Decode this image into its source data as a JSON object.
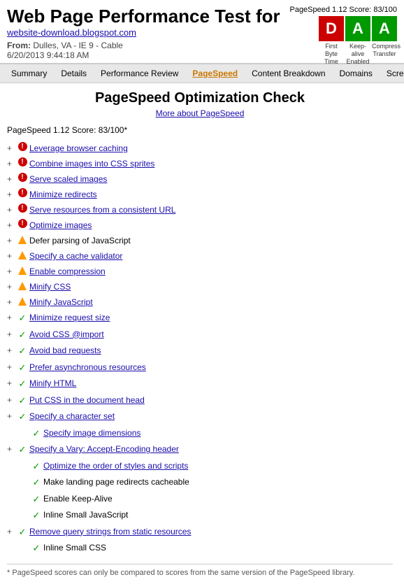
{
  "header": {
    "title": "Web Page Performance Test for",
    "site": "website-download.blogspot.com",
    "from_label": "From:",
    "from_value": "Dulles, VA - IE 9 - Cable",
    "date": "6/20/2013 9:44:18 AM"
  },
  "score_badge": {
    "label": "PageSpeed 1.12 Score: 83/100",
    "d_letter": "D",
    "a1_letter": "A",
    "a2_letter": "A",
    "d_class": "badge-red",
    "a1_class": "badge-green",
    "a2_class": "badge-green",
    "label1": "First Byte Time",
    "label2": "Keep-alive Enabled",
    "label3": "Compress Transfer"
  },
  "navbar": {
    "items": [
      {
        "label": "Summary",
        "active": false
      },
      {
        "label": "Details",
        "active": false
      },
      {
        "label": "Performance Review",
        "active": false
      },
      {
        "label": "PageSpeed",
        "active": true
      },
      {
        "label": "Content Breakdown",
        "active": false
      },
      {
        "label": "Domains",
        "active": false
      },
      {
        "label": "Screen Shot",
        "active": false
      }
    ]
  },
  "main": {
    "page_title": "PageSpeed Optimization Check",
    "more_link": "More about PageSpeed",
    "score_line": "PageSpeed 1.12 Score: 83/100*",
    "items": [
      {
        "type": "red",
        "text": "Leverage browser caching",
        "link": true,
        "indent": 0,
        "expandable": true
      },
      {
        "type": "red",
        "text": "Combine images into CSS sprites",
        "link": true,
        "indent": 0,
        "expandable": true
      },
      {
        "type": "red",
        "text": "Serve scaled images",
        "link": true,
        "indent": 0,
        "expandable": true
      },
      {
        "type": "red",
        "text": "Minimize redirects",
        "link": true,
        "indent": 0,
        "expandable": true
      },
      {
        "type": "red",
        "text": "Serve resources from a consistent URL",
        "link": true,
        "indent": 0,
        "expandable": true
      },
      {
        "type": "red",
        "text": "Optimize images",
        "link": true,
        "indent": 0,
        "expandable": true
      },
      {
        "type": "orange",
        "text": "Defer parsing of JavaScript",
        "link": false,
        "indent": 0,
        "expandable": true
      },
      {
        "type": "orange",
        "text": "Specify a cache validator",
        "link": true,
        "indent": 0,
        "expandable": true
      },
      {
        "type": "orange",
        "text": "Enable compression",
        "link": true,
        "indent": 0,
        "expandable": true
      },
      {
        "type": "orange",
        "text": "Minify CSS",
        "link": true,
        "indent": 0,
        "expandable": true
      },
      {
        "type": "orange",
        "text": "Minify JavaScript",
        "link": true,
        "indent": 0,
        "expandable": true
      },
      {
        "type": "green",
        "text": "Minimize request size",
        "link": true,
        "indent": 0,
        "expandable": true
      },
      {
        "type": "green",
        "text": "Avoid CSS @import",
        "link": true,
        "indent": 0,
        "expandable": true
      },
      {
        "type": "green",
        "text": "Avoid bad requests",
        "link": true,
        "indent": 0,
        "expandable": true
      },
      {
        "type": "green",
        "text": "Prefer asynchronous resources",
        "link": true,
        "indent": 0,
        "expandable": true
      },
      {
        "type": "green",
        "text": "Minify HTML",
        "link": true,
        "indent": 0,
        "expandable": true
      },
      {
        "type": "green",
        "text": "Put CSS in the document head",
        "link": true,
        "indent": 0,
        "expandable": true
      },
      {
        "type": "green",
        "text": "Specify a character set",
        "link": true,
        "indent": 0,
        "expandable": true
      },
      {
        "type": "green",
        "text": "Specify image dimensions",
        "link": true,
        "indent": 1,
        "expandable": false
      },
      {
        "type": "green",
        "text": "Specify a Vary: Accept-Encoding header",
        "link": true,
        "indent": 0,
        "expandable": true
      },
      {
        "type": "green",
        "text": "Optimize the order of styles and scripts",
        "link": true,
        "indent": 1,
        "expandable": false
      },
      {
        "type": "green",
        "text": "Make landing page redirects cacheable",
        "link": false,
        "indent": 1,
        "expandable": false
      },
      {
        "type": "green",
        "text": "Enable Keep-Alive",
        "link": false,
        "indent": 1,
        "expandable": false
      },
      {
        "type": "green",
        "text": "Inline Small JavaScript",
        "link": false,
        "indent": 1,
        "expandable": false
      },
      {
        "type": "green",
        "text": "Remove query strings from static resources",
        "link": true,
        "indent": 0,
        "expandable": true
      },
      {
        "type": "green",
        "text": "Inline Small CSS",
        "link": false,
        "indent": 1,
        "expandable": false
      }
    ],
    "footer_note": "* PageSpeed scores can only be compared to scores from the same version of the PageSpeed library."
  }
}
